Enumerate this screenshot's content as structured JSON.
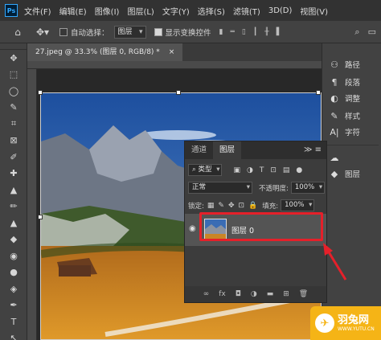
{
  "app": {
    "logo": "Ps"
  },
  "menu": [
    "文件(F)",
    "编辑(E)",
    "图像(I)",
    "图层(L)",
    "文字(Y)",
    "选择(S)",
    "滤镜(T)",
    "3D(D)",
    "视图(V)"
  ],
  "options": {
    "auto_select_label": "自动选择：",
    "auto_select_value": "图层",
    "show_transform_label": "显示变换控件",
    "align_icons": [
      "▮",
      "═",
      "▯",
      "┃",
      "╫",
      "▌"
    ]
  },
  "document": {
    "tab_title": "27.jpeg @ 33.3% (图层 0, RGB/8) *",
    "close_glyph": "×"
  },
  "tools": [
    "✥",
    "⬚",
    "◯",
    "✎",
    "⌗",
    "⊠",
    "✐",
    "✚",
    "▲",
    "✏",
    "▲",
    "◆",
    "◉",
    "●",
    "◈",
    "✒",
    "T",
    "↖"
  ],
  "right_panel": [
    {
      "icon": "⚇",
      "label": "路径"
    },
    {
      "icon": "¶",
      "label": "段落"
    },
    {
      "icon": "◐",
      "label": "调整"
    },
    {
      "icon": "✎",
      "label": "样式"
    },
    {
      "icon": "A|",
      "label": "字符"
    },
    {
      "icon": "☁",
      "label": ""
    },
    {
      "icon": "◆",
      "label": "图层"
    }
  ],
  "layers_panel": {
    "tabs": [
      "通道",
      "图层"
    ],
    "menu_glyph": "≫  ≡",
    "filter_kind": "类型",
    "blend_mode": "正常",
    "opacity_label": "不透明度:",
    "opacity_value": "100%",
    "lock_label": "锁定:",
    "fill_label": "填充:",
    "fill_value": "100%",
    "layer_name": "图层 0",
    "bottom_icons": [
      "∞",
      "fx",
      "◘",
      "◑",
      "▬",
      "⊞",
      "🗑"
    ]
  },
  "watermark": {
    "brand": "羽兔网",
    "url": "WWW.YUTU.CN"
  },
  "colors": {
    "highlight": "#e5202a",
    "watermark": "#f5b416"
  }
}
